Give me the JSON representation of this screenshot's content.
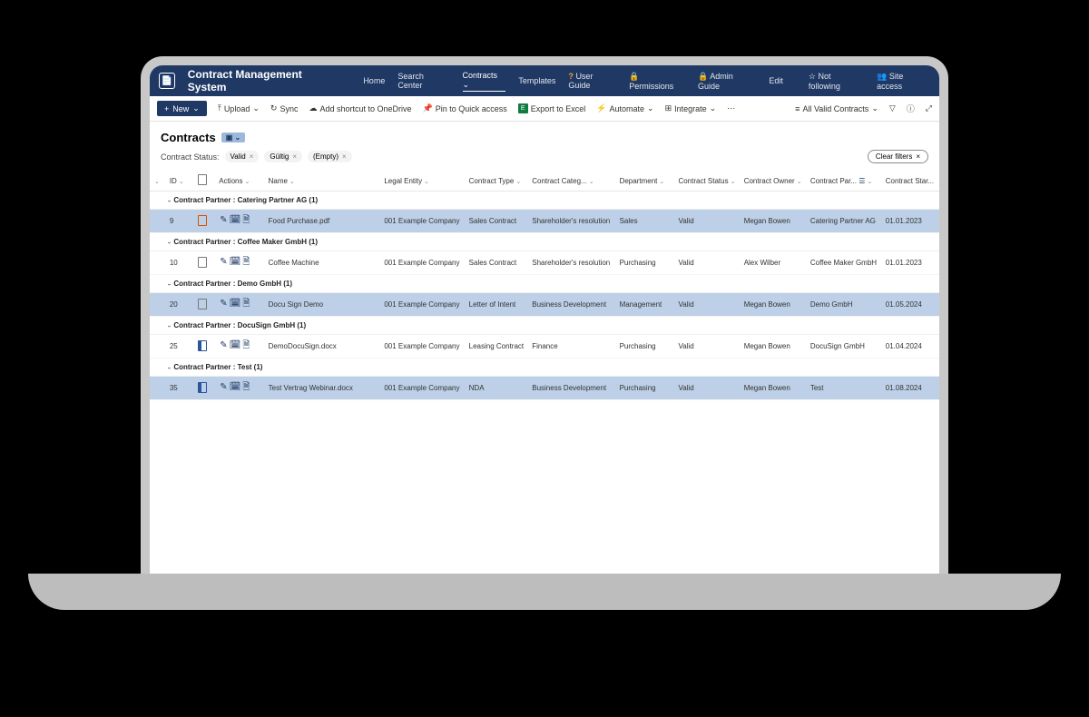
{
  "header": {
    "title": "Contract Management System",
    "nav": [
      "Home",
      "Search Center",
      "Contracts",
      "Templates",
      "User Guide",
      "Permissions",
      "Admin Guide",
      "Edit"
    ],
    "not_following": "Not following",
    "site_access": "Site access"
  },
  "cmdbar": {
    "new": "New",
    "upload": "Upload",
    "sync": "Sync",
    "shortcut": "Add shortcut to OneDrive",
    "pin": "Pin to Quick access",
    "excel": "Export to Excel",
    "automate": "Automate",
    "integrate": "Integrate",
    "view": "All Valid Contracts"
  },
  "page": {
    "title": "Contracts"
  },
  "filters": {
    "label": "Contract Status:",
    "chips": [
      "Valid",
      "Gültig",
      "(Empty)"
    ],
    "clear": "Clear filters"
  },
  "columns": {
    "id": "ID",
    "actions": "Actions",
    "name": "Name",
    "legal": "Legal Entity",
    "ctype": "Contract Type",
    "ccat": "Contract Categ...",
    "dept": "Department",
    "cstatus": "Contract Status",
    "owner": "Contract Owner",
    "partner": "Contract Par...",
    "cstart": "Contract Star..."
  },
  "groups": [
    {
      "label": "Contract Partner : Catering Partner AG (1)",
      "rows": [
        {
          "hl": true,
          "id": "9",
          "doc": "pdf",
          "name": "Food Purchase.pdf",
          "legal": "001 Example Company",
          "ctype": "Sales Contract",
          "ccat": "Shareholder's resolution",
          "dept": "Sales",
          "cstatus": "Valid",
          "owner": "Megan Bowen",
          "partner": "Catering Partner AG",
          "date": "01.01.2023"
        }
      ]
    },
    {
      "label": "Contract Partner : Coffee Maker GmbH (1)",
      "rows": [
        {
          "hl": false,
          "id": "10",
          "doc": "blank",
          "name": "Coffee Machine",
          "legal": "001 Example Company",
          "ctype": "Sales Contract",
          "ccat": "Shareholder's resolution",
          "dept": "Purchasing",
          "cstatus": "Valid",
          "owner": "Alex Wilber",
          "partner": "Coffee Maker GmbH",
          "date": "01.01.2023"
        }
      ]
    },
    {
      "label": "Contract Partner : Demo GmbH (1)",
      "rows": [
        {
          "hl": true,
          "id": "20",
          "doc": "blank",
          "name": "Docu Sign Demo",
          "legal": "001 Example Company",
          "ctype": "Letter of Intent",
          "ccat": "Business Development",
          "dept": "Management",
          "cstatus": "Valid",
          "owner": "Megan Bowen",
          "partner": "Demo GmbH",
          "date": "01.05.2024"
        }
      ]
    },
    {
      "label": "Contract Partner : DocuSign GmbH (1)",
      "rows": [
        {
          "hl": false,
          "id": "25",
          "doc": "word",
          "name": "DemoDocuSign.docx",
          "legal": "001 Example Company",
          "ctype": "Leasing Contract",
          "ccat": "Finance",
          "dept": "Purchasing",
          "cstatus": "Valid",
          "owner": "Megan Bowen",
          "partner": "DocuSign GmbH",
          "date": "01.04.2024"
        }
      ]
    },
    {
      "label": "Contract Partner : Test (1)",
      "rows": [
        {
          "hl": true,
          "id": "35",
          "doc": "word",
          "name": "Test Vertrag Webinar.docx",
          "legal": "001 Example Company",
          "ctype": "NDA",
          "ccat": "Business Development",
          "dept": "Purchasing",
          "cstatus": "Valid",
          "owner": "Megan Bowen",
          "partner": "Test",
          "date": "01.08.2024"
        }
      ]
    }
  ]
}
